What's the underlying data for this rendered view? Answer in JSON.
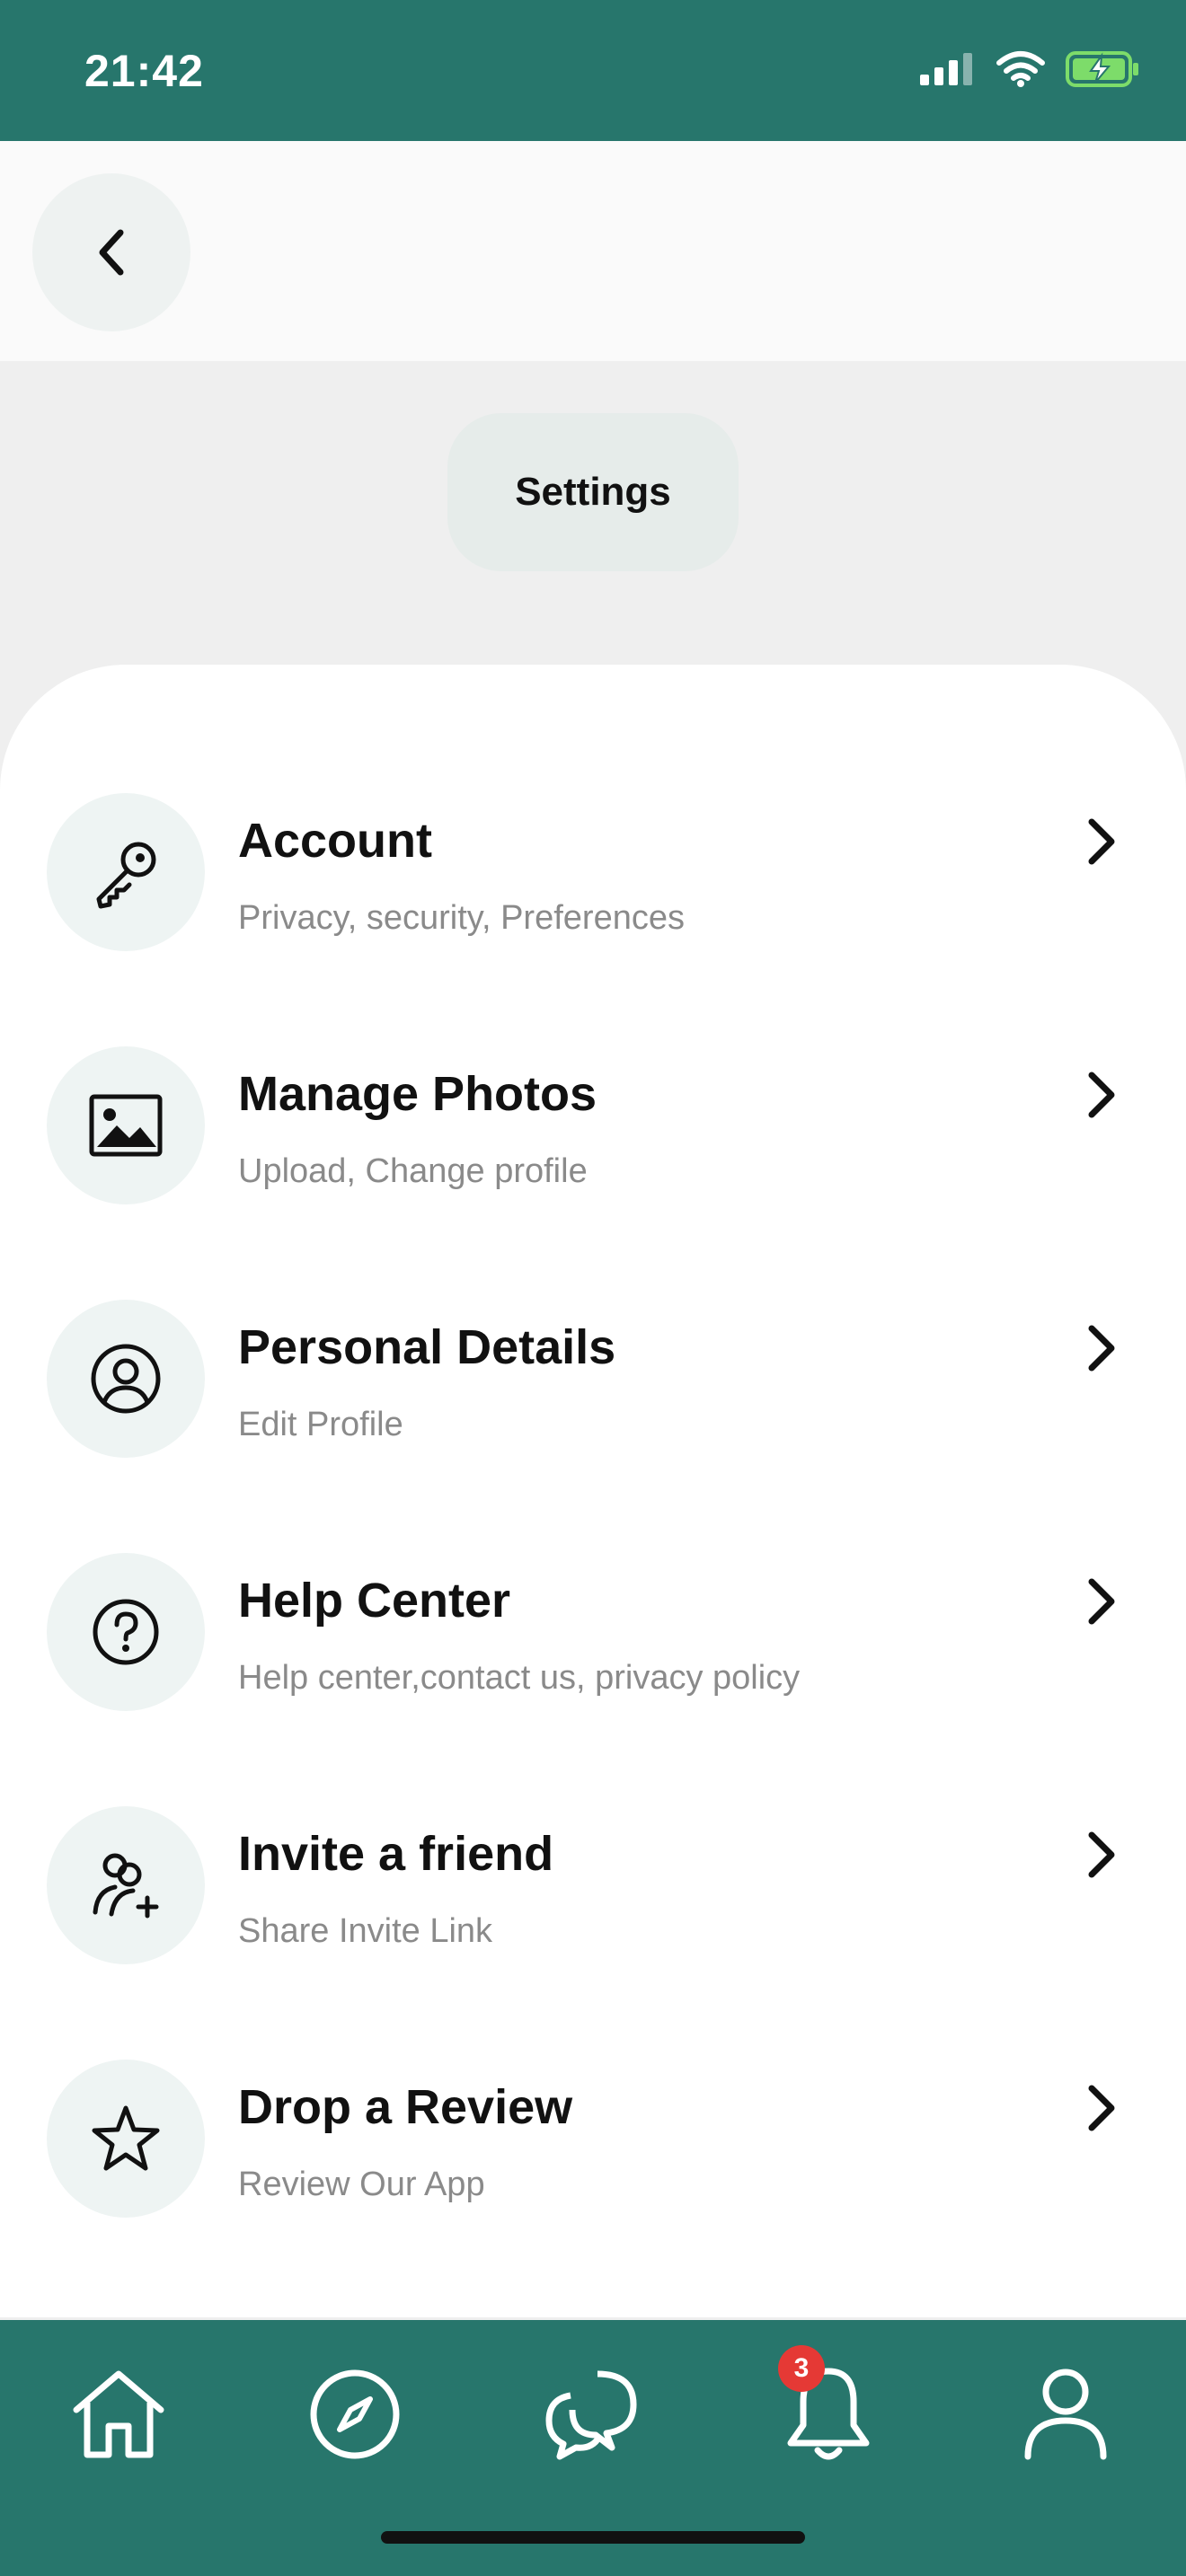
{
  "status_bar": {
    "time": "21:42",
    "icons": [
      "signal-icon",
      "wifi-icon",
      "battery-charging-icon"
    ],
    "color": "#27766c"
  },
  "header": {
    "back_icon": "chevron-left-icon",
    "title": "Settings"
  },
  "menu": [
    {
      "title": "Account",
      "subtitle": "Privacy, security, Preferences",
      "icon": "key-icon"
    },
    {
      "title": "Manage Photos",
      "subtitle": "Upload, Change profile",
      "icon": "image-icon"
    },
    {
      "title": "Personal Details",
      "subtitle": "Edit Profile",
      "icon": "user-circle-icon"
    },
    {
      "title": "Help Center",
      "subtitle": "Help center,contact us, privacy policy",
      "icon": "help-circle-icon"
    },
    {
      "title": "Invite a friend",
      "subtitle": "Share Invite Link",
      "icon": "user-plus-icon"
    },
    {
      "title": "Drop a Review",
      "subtitle": "Review Our App",
      "icon": "star-icon"
    }
  ],
  "bottom_nav": {
    "items": [
      "home-icon",
      "compass-icon",
      "chat-icon",
      "bell-icon",
      "profile-icon"
    ],
    "notification_count": "3",
    "color": "#27766c",
    "badge_color": "#e53935"
  }
}
